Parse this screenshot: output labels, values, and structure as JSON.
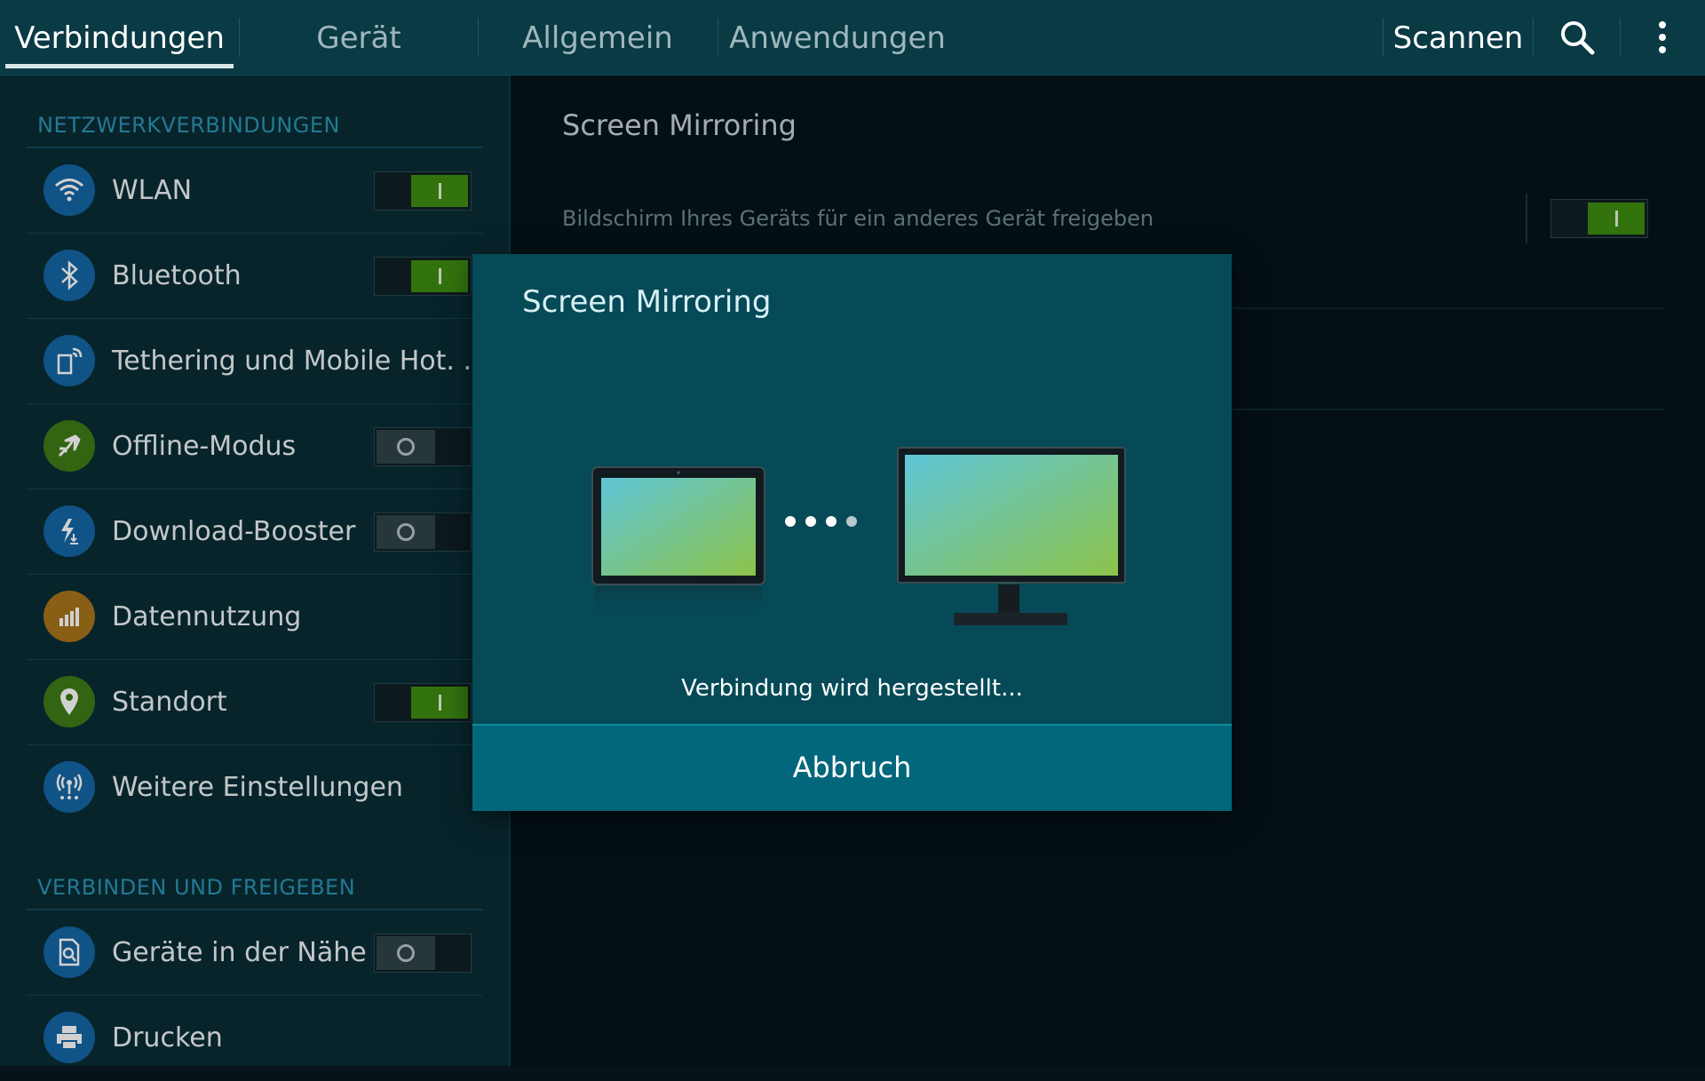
{
  "topbar": {
    "tabs": [
      {
        "label": "Verbindungen",
        "active": true
      },
      {
        "label": "Gerät",
        "active": false
      },
      {
        "label": "Allgemein",
        "active": false
      },
      {
        "label": "Anwendungen",
        "active": false
      }
    ],
    "scan_label": "Scannen",
    "search_icon": "search-icon",
    "menu_icon": "more-vert-icon"
  },
  "sidebar": {
    "section_network": "NETZWERKVERBINDUNGEN",
    "section_share": "VERBINDEN UND FREIGEBEN",
    "items": [
      {
        "label": "WLAN",
        "icon": "wifi-icon",
        "toggle": "on"
      },
      {
        "label": "Bluetooth",
        "icon": "bluetooth-icon",
        "toggle": "on"
      },
      {
        "label": "Tethering und Mobile Hot. .",
        "icon": "tethering-icon",
        "toggle": "none"
      },
      {
        "label": "Offline-Modus",
        "icon": "airplane-icon",
        "toggle": "off"
      },
      {
        "label": "Download-Booster",
        "icon": "download-booster-icon",
        "toggle": "off"
      },
      {
        "label": "Datennutzung",
        "icon": "data-usage-icon",
        "toggle": "none"
      },
      {
        "label": "Standort",
        "icon": "location-icon",
        "toggle": "on"
      },
      {
        "label": "Weitere Einstellungen",
        "icon": "more-networks-icon",
        "toggle": "none"
      },
      {
        "label": "Geräte in der Nähe",
        "icon": "nearby-devices-icon",
        "toggle": "off"
      },
      {
        "label": "Drucken",
        "icon": "printer-icon",
        "toggle": "none"
      }
    ]
  },
  "content": {
    "title": "Screen Mirroring",
    "description": "Bildschirm Ihres Geräts für ein anderes Gerät freigeben",
    "toggle": "on"
  },
  "dialog": {
    "title": "Screen Mirroring",
    "status": "Verbindung wird hergestellt...",
    "cancel_label": "Abbruch"
  },
  "colors": {
    "accent_green": "#3f8d12",
    "section_blue": "#2c94b4",
    "dialog_bg": "#064a57",
    "dialog_button": "#03677c"
  }
}
